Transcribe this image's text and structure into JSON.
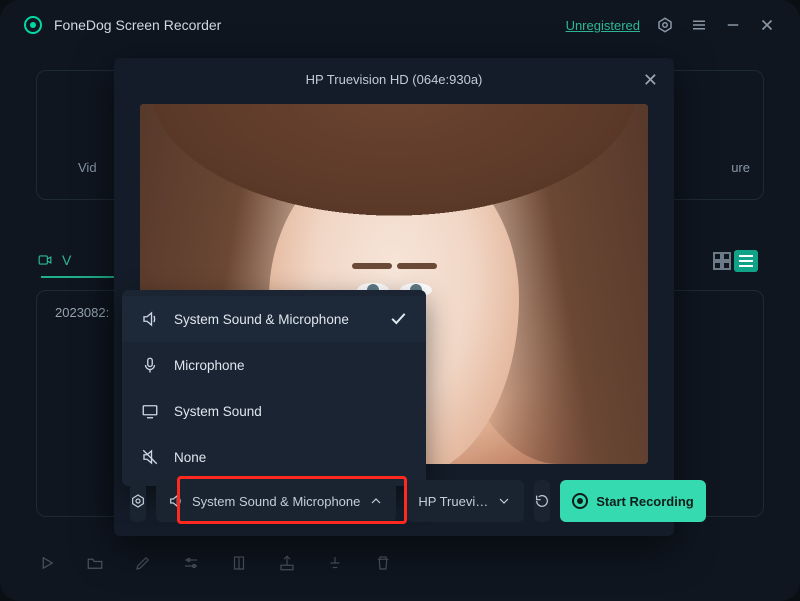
{
  "titlebar": {
    "title": "FoneDog Screen Recorder",
    "unregistered": "Unregistered"
  },
  "background": {
    "left_label": "Vid",
    "right_label": "ure",
    "tab": "V",
    "list_row": "2023082:"
  },
  "modal": {
    "title": "HP Truevision HD (064e:930a)",
    "audio_menu": {
      "selected_index": 0,
      "items": [
        {
          "label": "System Sound & Microphone",
          "icon": "speaker-icon"
        },
        {
          "label": "Microphone",
          "icon": "mic-icon"
        },
        {
          "label": "System Sound",
          "icon": "monitor-icon"
        },
        {
          "label": "None",
          "icon": "muted-icon"
        }
      ]
    },
    "controls": {
      "audio_label": "System Sound & Microphone",
      "camera_label": "HP Truevi…",
      "start_label": "Start Recording"
    }
  }
}
